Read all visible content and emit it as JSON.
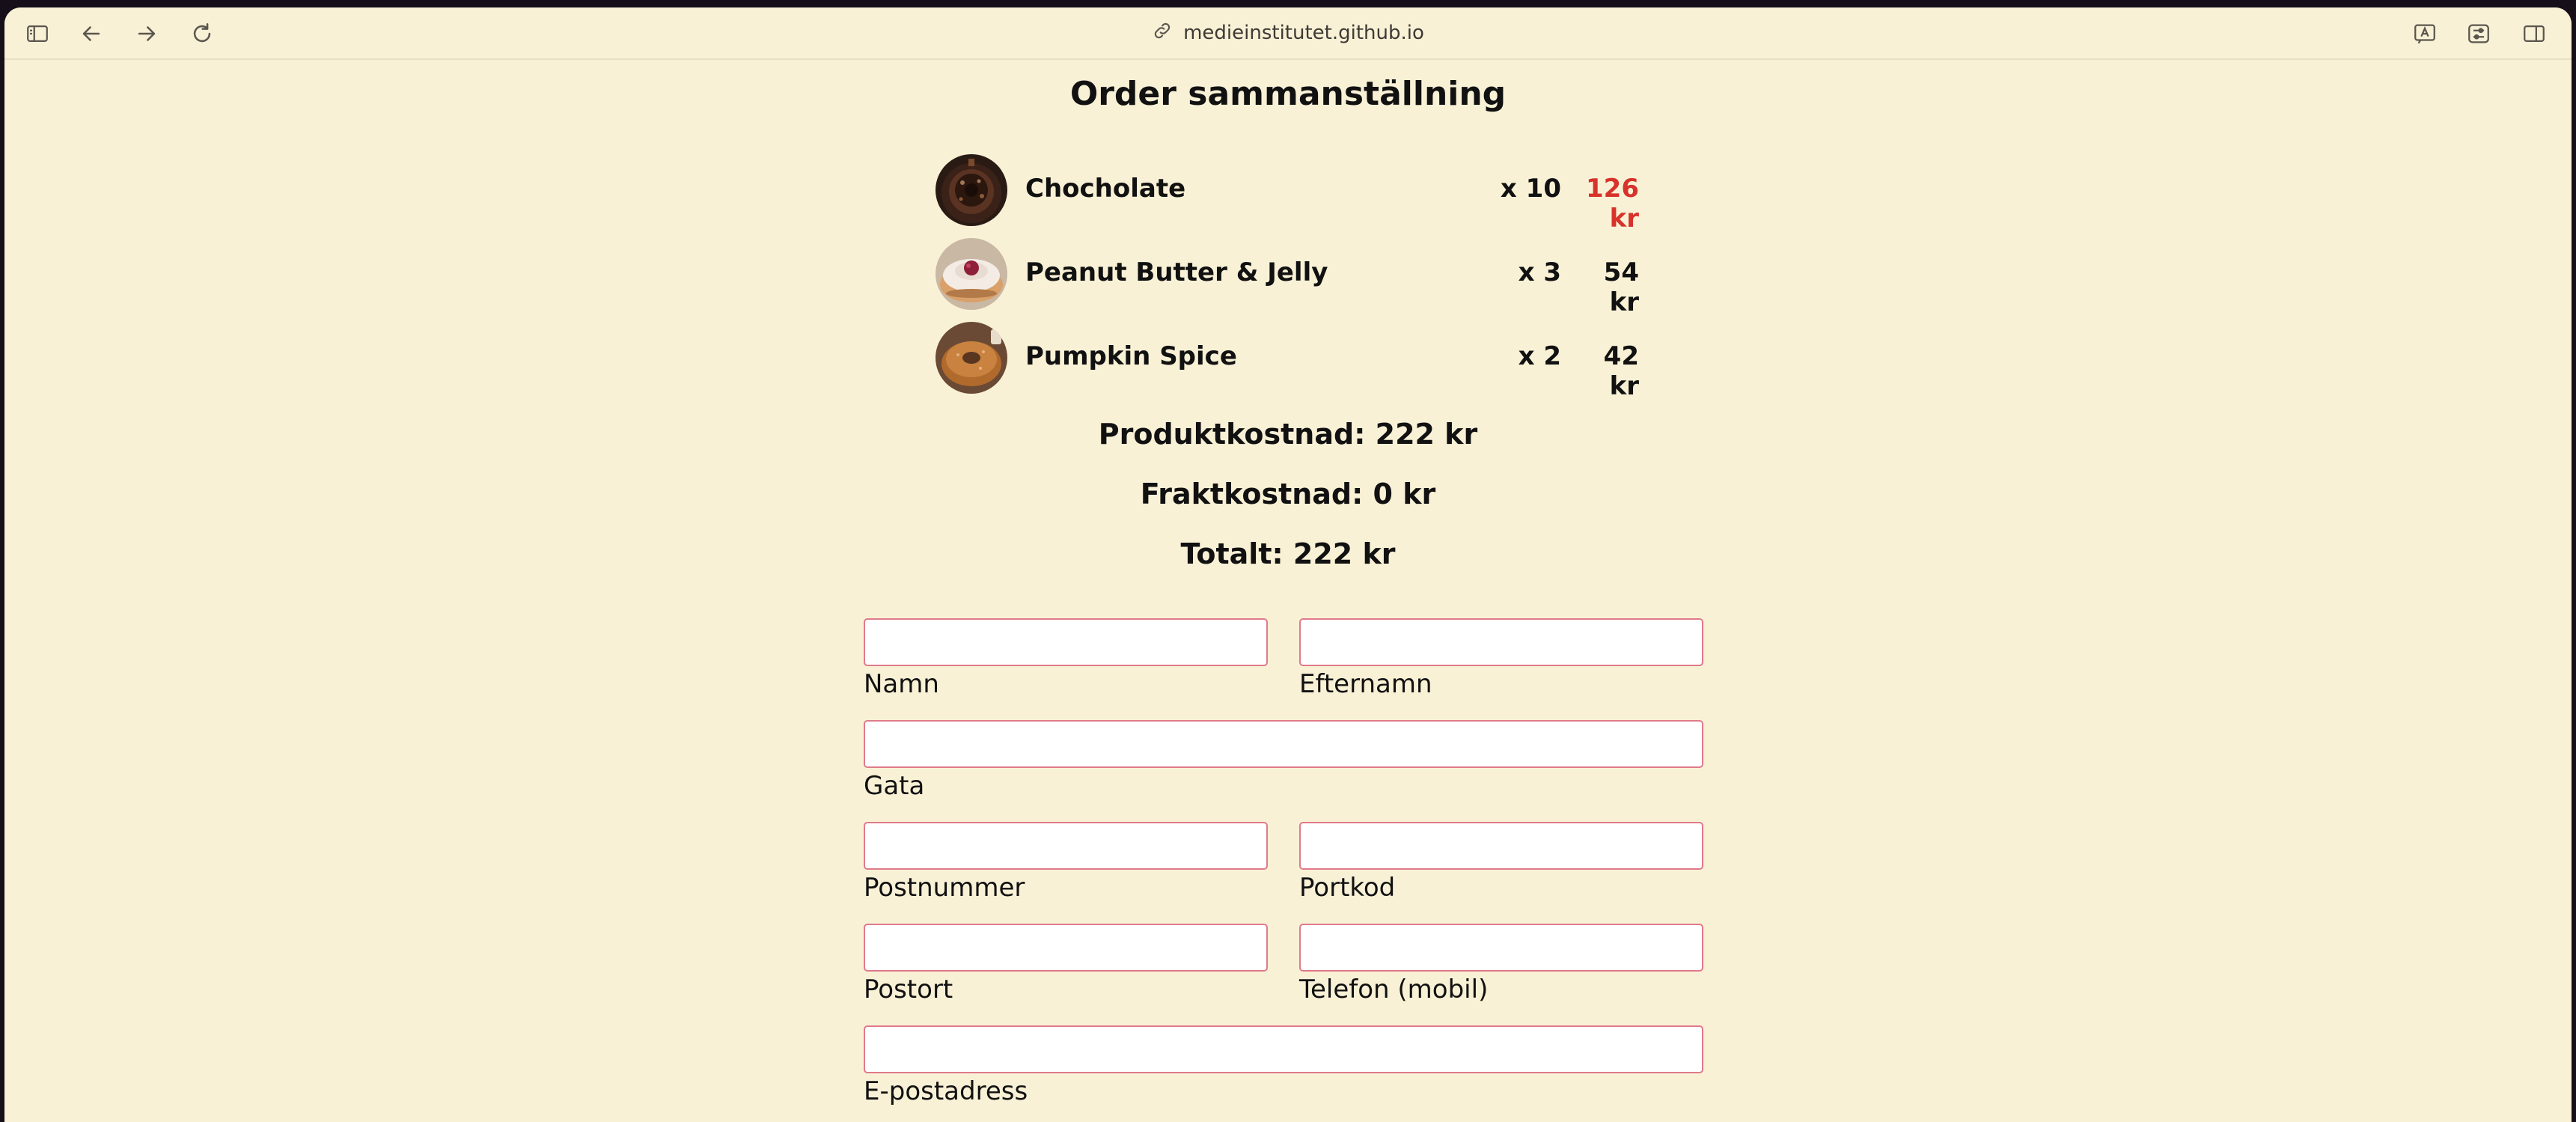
{
  "browser": {
    "url": "medieinstitutet.github.io",
    "icons": {
      "sidebar": "sidebar-icon",
      "back": "back-arrow-icon",
      "forward": "forward-arrow-icon",
      "reload": "reload-icon",
      "link": "link-icon",
      "translate": "translate-icon",
      "reader": "reader-settings-icon",
      "split": "split-view-icon"
    }
  },
  "order": {
    "title": "Order sammanställning",
    "items": [
      {
        "name": "Chocholate",
        "qty": "x 10",
        "price": "126 kr",
        "price_color": "#d7332b",
        "thumb": "chocolate-donut-image"
      },
      {
        "name": "Peanut Butter & Jelly",
        "qty": "x 3",
        "price": "54 kr",
        "thumb": "pbj-donut-image"
      },
      {
        "name": "Pumpkin Spice",
        "qty": "x 2",
        "price": "42 kr",
        "thumb": "pumpkin-donut-image"
      }
    ],
    "product_cost": "Produktkostnad: 222 kr",
    "shipping_cost": "Fraktkostnad: 0 kr",
    "total": "Totalt: 222 kr"
  },
  "form": {
    "first_name": {
      "label": "Namn",
      "value": ""
    },
    "last_name": {
      "label": "Efternamn",
      "value": ""
    },
    "street": {
      "label": "Gata",
      "value": ""
    },
    "postal_code": {
      "label": "Postnummer",
      "value": ""
    },
    "door_code": {
      "label": "Portkod",
      "value": ""
    },
    "city": {
      "label": "Postort",
      "value": ""
    },
    "phone": {
      "label": "Telefon (mobil)",
      "value": ""
    },
    "email": {
      "label": "E-postadress",
      "value": ""
    }
  },
  "colors": {
    "background": "#f9f1d6",
    "accent_price": "#d7332b",
    "input_border": "#e07a8a"
  }
}
